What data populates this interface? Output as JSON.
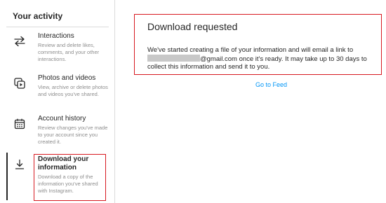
{
  "sidebar": {
    "title": "Your activity",
    "items": [
      {
        "label": "Interactions",
        "description": "Review and delete likes, comments, and your other interactions.",
        "icon": "arrows-swap-icon"
      },
      {
        "label": "Photos and videos",
        "description": "View, archive or delete photos and videos you've shared.",
        "icon": "photos-videos-icon"
      },
      {
        "label": "Account history",
        "description": "Review changes you've made to your account since you created it.",
        "icon": "calendar-icon"
      },
      {
        "label": "Download your information",
        "description": "Download a copy of the information you've shared with Instagram.",
        "icon": "download-icon",
        "active": true
      }
    ]
  },
  "main": {
    "title": "Download requested",
    "body_part1": "We've started creating a file of your information and will email a link to ",
    "body_part2": "@gmail.com once it's ready. It may take up to 30 days to collect this information and send it to you.",
    "link": "Go to Feed"
  },
  "colors": {
    "link": "#0095f6",
    "highlight": "#d71920",
    "text": "#262626",
    "muted": "#8e8e8e"
  }
}
